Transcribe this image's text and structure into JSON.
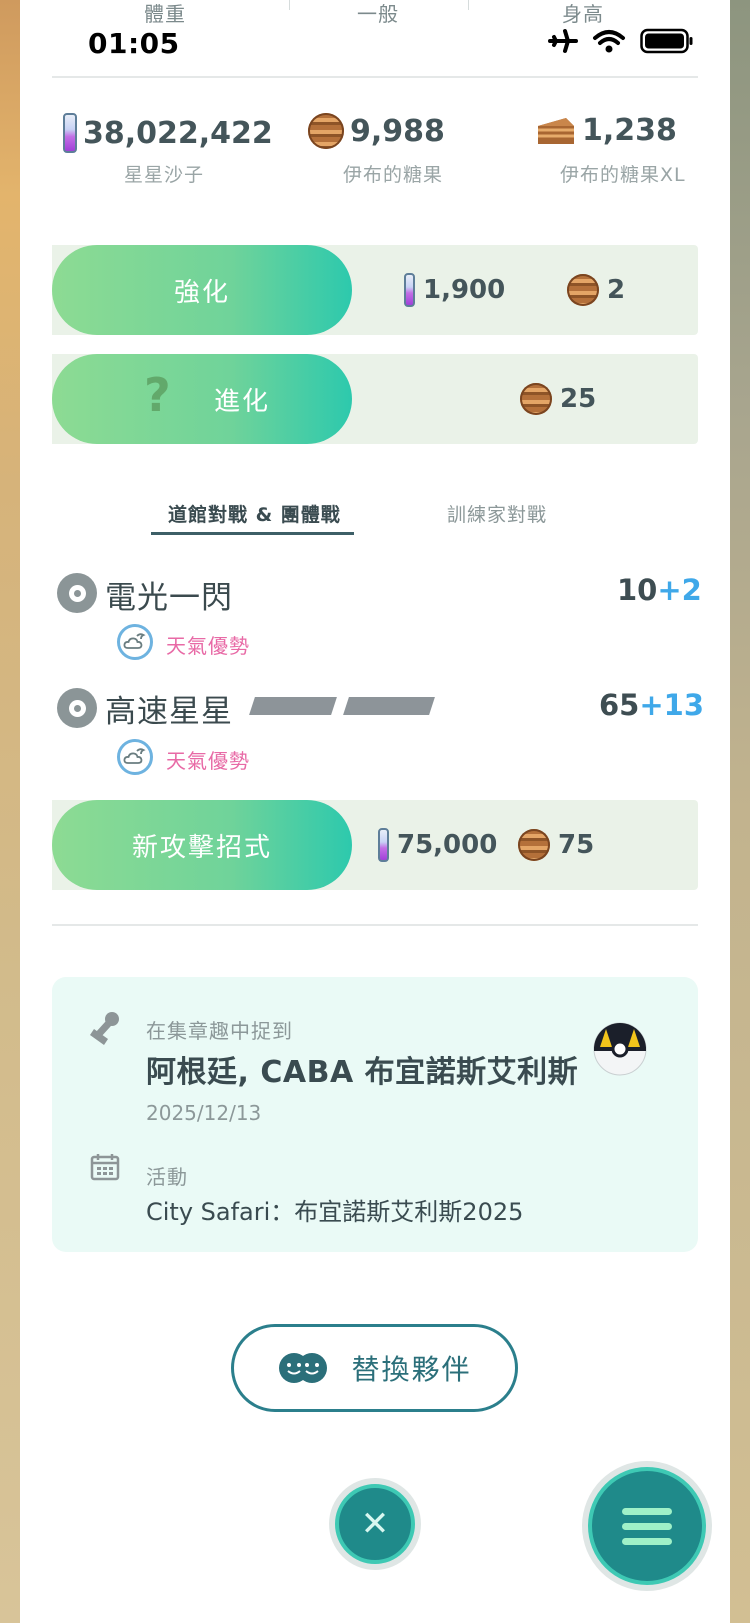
{
  "status_bar": {
    "time": "01:05",
    "icons": [
      "airplane-icon",
      "wifi-icon",
      "battery-icon"
    ]
  },
  "stat_headers": [
    "體重",
    "一般",
    "身高"
  ],
  "resources": [
    {
      "name": "stardust",
      "value": "38,022,422",
      "label": "星星沙子"
    },
    {
      "name": "candy",
      "value": "9,988",
      "label": "伊布的糖果"
    },
    {
      "name": "candy-xl",
      "value": "1,238",
      "label": "伊布的糖果XL"
    }
  ],
  "power_up": {
    "label": "強化",
    "stardust_cost": "1,900",
    "candy_cost": "2"
  },
  "evolve": {
    "icon": "?",
    "label": "進化",
    "candy_cost": "25"
  },
  "tabs": [
    {
      "label": "道館對戰 & 團體戰",
      "active": true
    },
    {
      "label": "訓練家對戰",
      "active": false
    }
  ],
  "moves": [
    {
      "name": "電光一閃",
      "power": "10",
      "bonus": "+2",
      "weather": "天氣優勢"
    },
    {
      "name": "高速星星",
      "power": "65",
      "bonus": "+13",
      "weather": "天氣優勢",
      "energy_bars": 2
    }
  ],
  "new_move": {
    "label": "新攻擊招式",
    "stardust_cost": "75,000",
    "candy_cost": "75"
  },
  "catch_info": {
    "caught_label": "在集章趣中捉到",
    "location": "阿根廷, CABA 布宜諾斯艾利斯",
    "date": "2025/12/13",
    "event_label": "活動",
    "event_name": "City Safari：布宜諾斯艾利斯2025"
  },
  "swap_button": {
    "label": "替換夥伴"
  },
  "colors": {
    "accent": "#2b7f8c",
    "pill_start": "#8ddb93",
    "pill_end": "#2dc9ad",
    "weather": "#e86aa6",
    "bonus": "#3fa8e9"
  }
}
